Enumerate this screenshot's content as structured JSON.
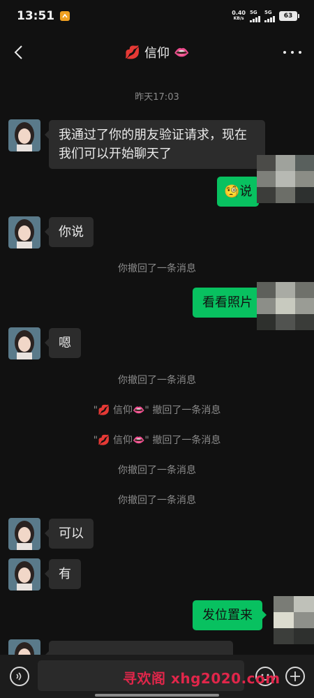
{
  "status_bar": {
    "time": "13:51",
    "net_speed_value": "0.40",
    "net_speed_unit": "KB/s",
    "signal_1": "5G",
    "signal_2": "5G",
    "battery": "63"
  },
  "nav": {
    "title": "信仰",
    "title_emoji_left": "💋",
    "title_emoji_right": "👄"
  },
  "chat": {
    "timestamp": "昨天17:03",
    "messages": [
      {
        "type": "in",
        "text": "我通过了你的朋友验证请求，现在我们可以开始聊天了"
      },
      {
        "type": "out",
        "text": "说",
        "emoji": "🧐"
      },
      {
        "type": "in",
        "text": "你说"
      },
      {
        "type": "system",
        "text": "你撤回了一条消息"
      },
      {
        "type": "out",
        "text": "看看照片"
      },
      {
        "type": "in",
        "text": "嗯"
      },
      {
        "type": "system",
        "text": "你撤回了一条消息"
      },
      {
        "type": "system",
        "text": "\"💋 信仰👄\" 撤回了一条消息"
      },
      {
        "type": "system",
        "text": "\"💋 信仰👄\" 撤回了一条消息"
      },
      {
        "type": "system",
        "text": "你撤回了一条消息"
      },
      {
        "type": "system",
        "text": "你撤回了一条消息"
      },
      {
        "type": "in",
        "text": "可以"
      },
      {
        "type": "in",
        "text": "有"
      },
      {
        "type": "out",
        "text": "发位置来"
      }
    ]
  },
  "watermark": "寻欢阁 xhg2020.com",
  "colors": {
    "background": "#111111",
    "bubble_in": "#2c2c2c",
    "bubble_out": "#08c160",
    "system_text": "#8a8a8a",
    "watermark": "#e0264a"
  },
  "icons": {
    "back": "chevron-left-icon",
    "more": "more-dots-icon",
    "voice": "voice-icon",
    "emoji": "emoji-icon",
    "plus": "plus-icon"
  }
}
